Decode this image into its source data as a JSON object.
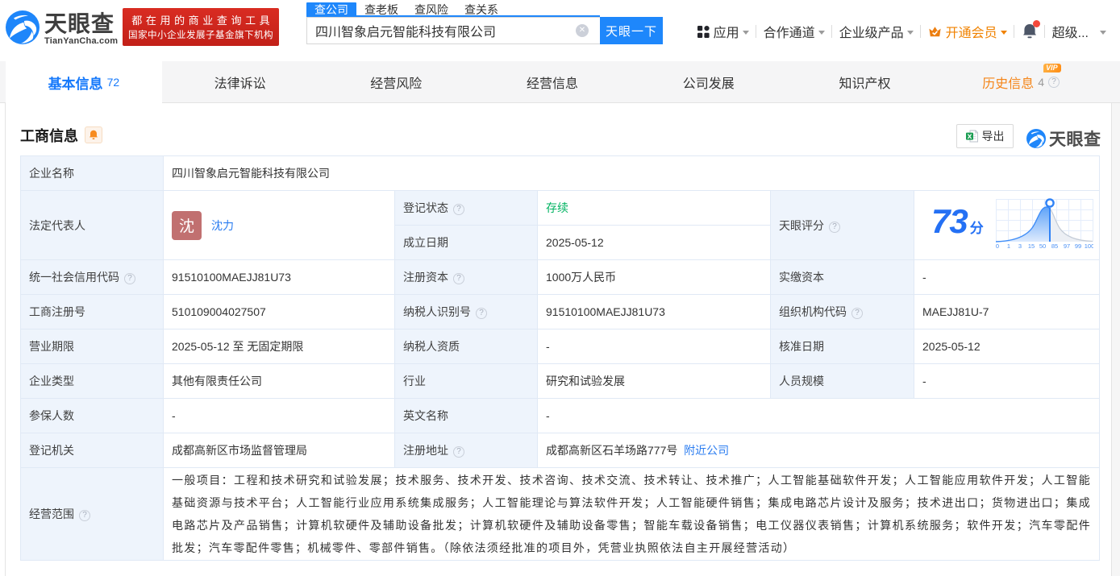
{
  "header": {
    "logo": {
      "cn": "天眼查",
      "en": "TianYanCha.com"
    },
    "banner": {
      "line1": "都在用的商业查询工具",
      "line2": "国家中小企业发展子基金旗下机构"
    },
    "search": {
      "tabs": [
        {
          "label": "查公司",
          "active": true
        },
        {
          "label": "查老板",
          "active": false
        },
        {
          "label": "查风险",
          "active": false
        },
        {
          "label": "查关系",
          "active": false
        }
      ],
      "value": "四川智象启元智能科技有限公司",
      "button": "天眼一下"
    },
    "menu": {
      "apps": "应用",
      "cooperation": "合作通道",
      "enterprise": "企业级产品",
      "vip": "开通会员",
      "account": "超级..."
    }
  },
  "nav": {
    "tabs": [
      {
        "label": "基本信息",
        "count": "72"
      },
      {
        "label": "法律诉讼",
        "count": ""
      },
      {
        "label": "经营风险",
        "count": ""
      },
      {
        "label": "经营信息",
        "count": ""
      },
      {
        "label": "公司发展",
        "count": ""
      },
      {
        "label": "知识产权",
        "count": ""
      },
      {
        "label": "历史信息",
        "count": "4",
        "vip_badge": "VIP"
      }
    ]
  },
  "section": {
    "title": "工商信息",
    "export_label": "导出",
    "watermark": "天眼查"
  },
  "company": {
    "name_label": "企业名称",
    "name": "四川智象启元智能科技有限公司",
    "legal_rep_label": "法定代表人",
    "legal_rep_avatar": "沈",
    "legal_rep": "沈力",
    "reg_status_label": "登记状态",
    "reg_status": "存续",
    "establish_label": "成立日期",
    "establish_date": "2025-05-12",
    "score_label": "天眼评分",
    "score": "73",
    "score_unit": "分",
    "credit_code_label": "统一社会信用代码",
    "credit_code": "91510100MAEJJ81U73",
    "reg_capital_label": "注册资本",
    "reg_capital": "1000万人民币",
    "paid_capital_label": "实缴资本",
    "paid_capital": "-",
    "reg_number_label": "工商注册号",
    "reg_number": "510109004027507",
    "taxpayer_id_label": "纳税人识别号",
    "taxpayer_id": "91510100MAEJJ81U73",
    "org_code_label": "组织机构代码",
    "org_code": "MAEJJ81U-7",
    "term_label": "营业期限",
    "term": "2025-05-12 至 无固定期限",
    "taxpayer_quality_label": "纳税人资质",
    "taxpayer_quality": "-",
    "approval_label": "核准日期",
    "approval_date": "2025-05-12",
    "type_label": "企业类型",
    "type": "其他有限责任公司",
    "industry_label": "行业",
    "industry": "研究和试验发展",
    "staff_label": "人员规模",
    "staff": "-",
    "insured_label": "参保人数",
    "insured": "-",
    "en_name_label": "英文名称",
    "en_name": "-",
    "authority_label": "登记机关",
    "authority": "成都高新区市场监督管理局",
    "address_label": "注册地址",
    "address": "成都高新区石羊场路777号",
    "address_link": "附近公司",
    "scope_label": "经营范围",
    "scope": "一般项目：工程和技术研究和试验发展；技术服务、技术开发、技术咨询、技术交流、技术转让、技术推广；人工智能基础软件开发；人工智能应用软件开发；人工智能基础资源与技术平台；人工智能行业应用系统集成服务；人工智能理论与算法软件开发；人工智能硬件销售；集成电路芯片设计及服务；技术进出口；货物进出口；集成电路芯片及产品销售；计算机软硬件及辅助设备批发；计算机软硬件及辅助设备零售；智能车载设备销售；电工仪器仪表销售；计算机系统服务；软件开发；汽车零配件批发；汽车零配件零售；机械零件、零部件销售。（除依法须经批准的项目外，凭营业执照依法自主开展经营活动）"
  },
  "icons": {
    "help_glyph": "?",
    "clear_glyph": "✕"
  },
  "chart_data": {
    "type": "area",
    "title": "天眼评分分布曲线",
    "x_ticks": [
      "0",
      "1",
      "3",
      "15",
      "50",
      "85",
      "97",
      "99",
      "100"
    ],
    "marker_value": 73,
    "marker_position_pct": 56,
    "ylim": [
      0,
      1
    ],
    "grid": true,
    "legend": false
  }
}
